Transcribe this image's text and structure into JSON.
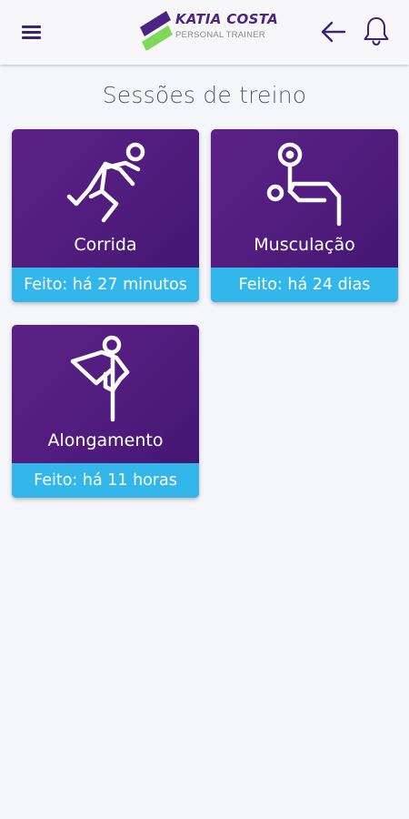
{
  "header": {
    "menu_icon": "hamburger-menu-icon",
    "logo": {
      "name": "KATIA COSTA",
      "subtitle": "PERSONAL TRAINER",
      "colors": {
        "primary": "#4a2585",
        "secondary": "#7ed957"
      }
    },
    "back_icon": "arrow-left-icon",
    "notification_icon": "bell-icon"
  },
  "page": {
    "title": "Sessões de treino"
  },
  "colors": {
    "card_background": "#4f1c7c",
    "card_footer": "#33b6ea",
    "page_background": "#f5f6fa"
  },
  "sessions": [
    {
      "name": "Corrida",
      "status": "Feito: há 27 minutos",
      "icon": "running-icon"
    },
    {
      "name": "Musculação",
      "status": "Feito: há 24 dias",
      "icon": "weightlifting-icon"
    },
    {
      "name": "Alongamento",
      "status": "Feito: há 11 horas",
      "icon": "stretching-icon"
    }
  ]
}
